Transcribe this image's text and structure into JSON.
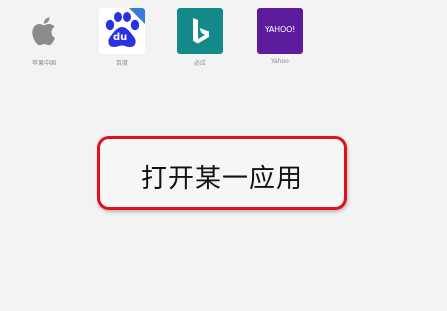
{
  "favorites": [
    {
      "id": "apple",
      "label": "苹果中国",
      "icon": "apple-icon"
    },
    {
      "id": "baidu",
      "label": "百度",
      "icon": "baidu-paw-icon",
      "logo_text": "du"
    },
    {
      "id": "bing",
      "label": "必应",
      "icon": "bing-icon"
    },
    {
      "id": "yahoo",
      "label": "Yahoo",
      "icon": "yahoo-icon",
      "logo_text": "YAHOO!"
    }
  ],
  "annotation": {
    "text": "打开某一应用"
  },
  "colors": {
    "background": "#f3f3f3",
    "annotation_border": "#e0101c",
    "bing_tile": "#128a8a",
    "yahoo_tile": "#5d1b9e",
    "baidu_blue": "#2932e1"
  }
}
